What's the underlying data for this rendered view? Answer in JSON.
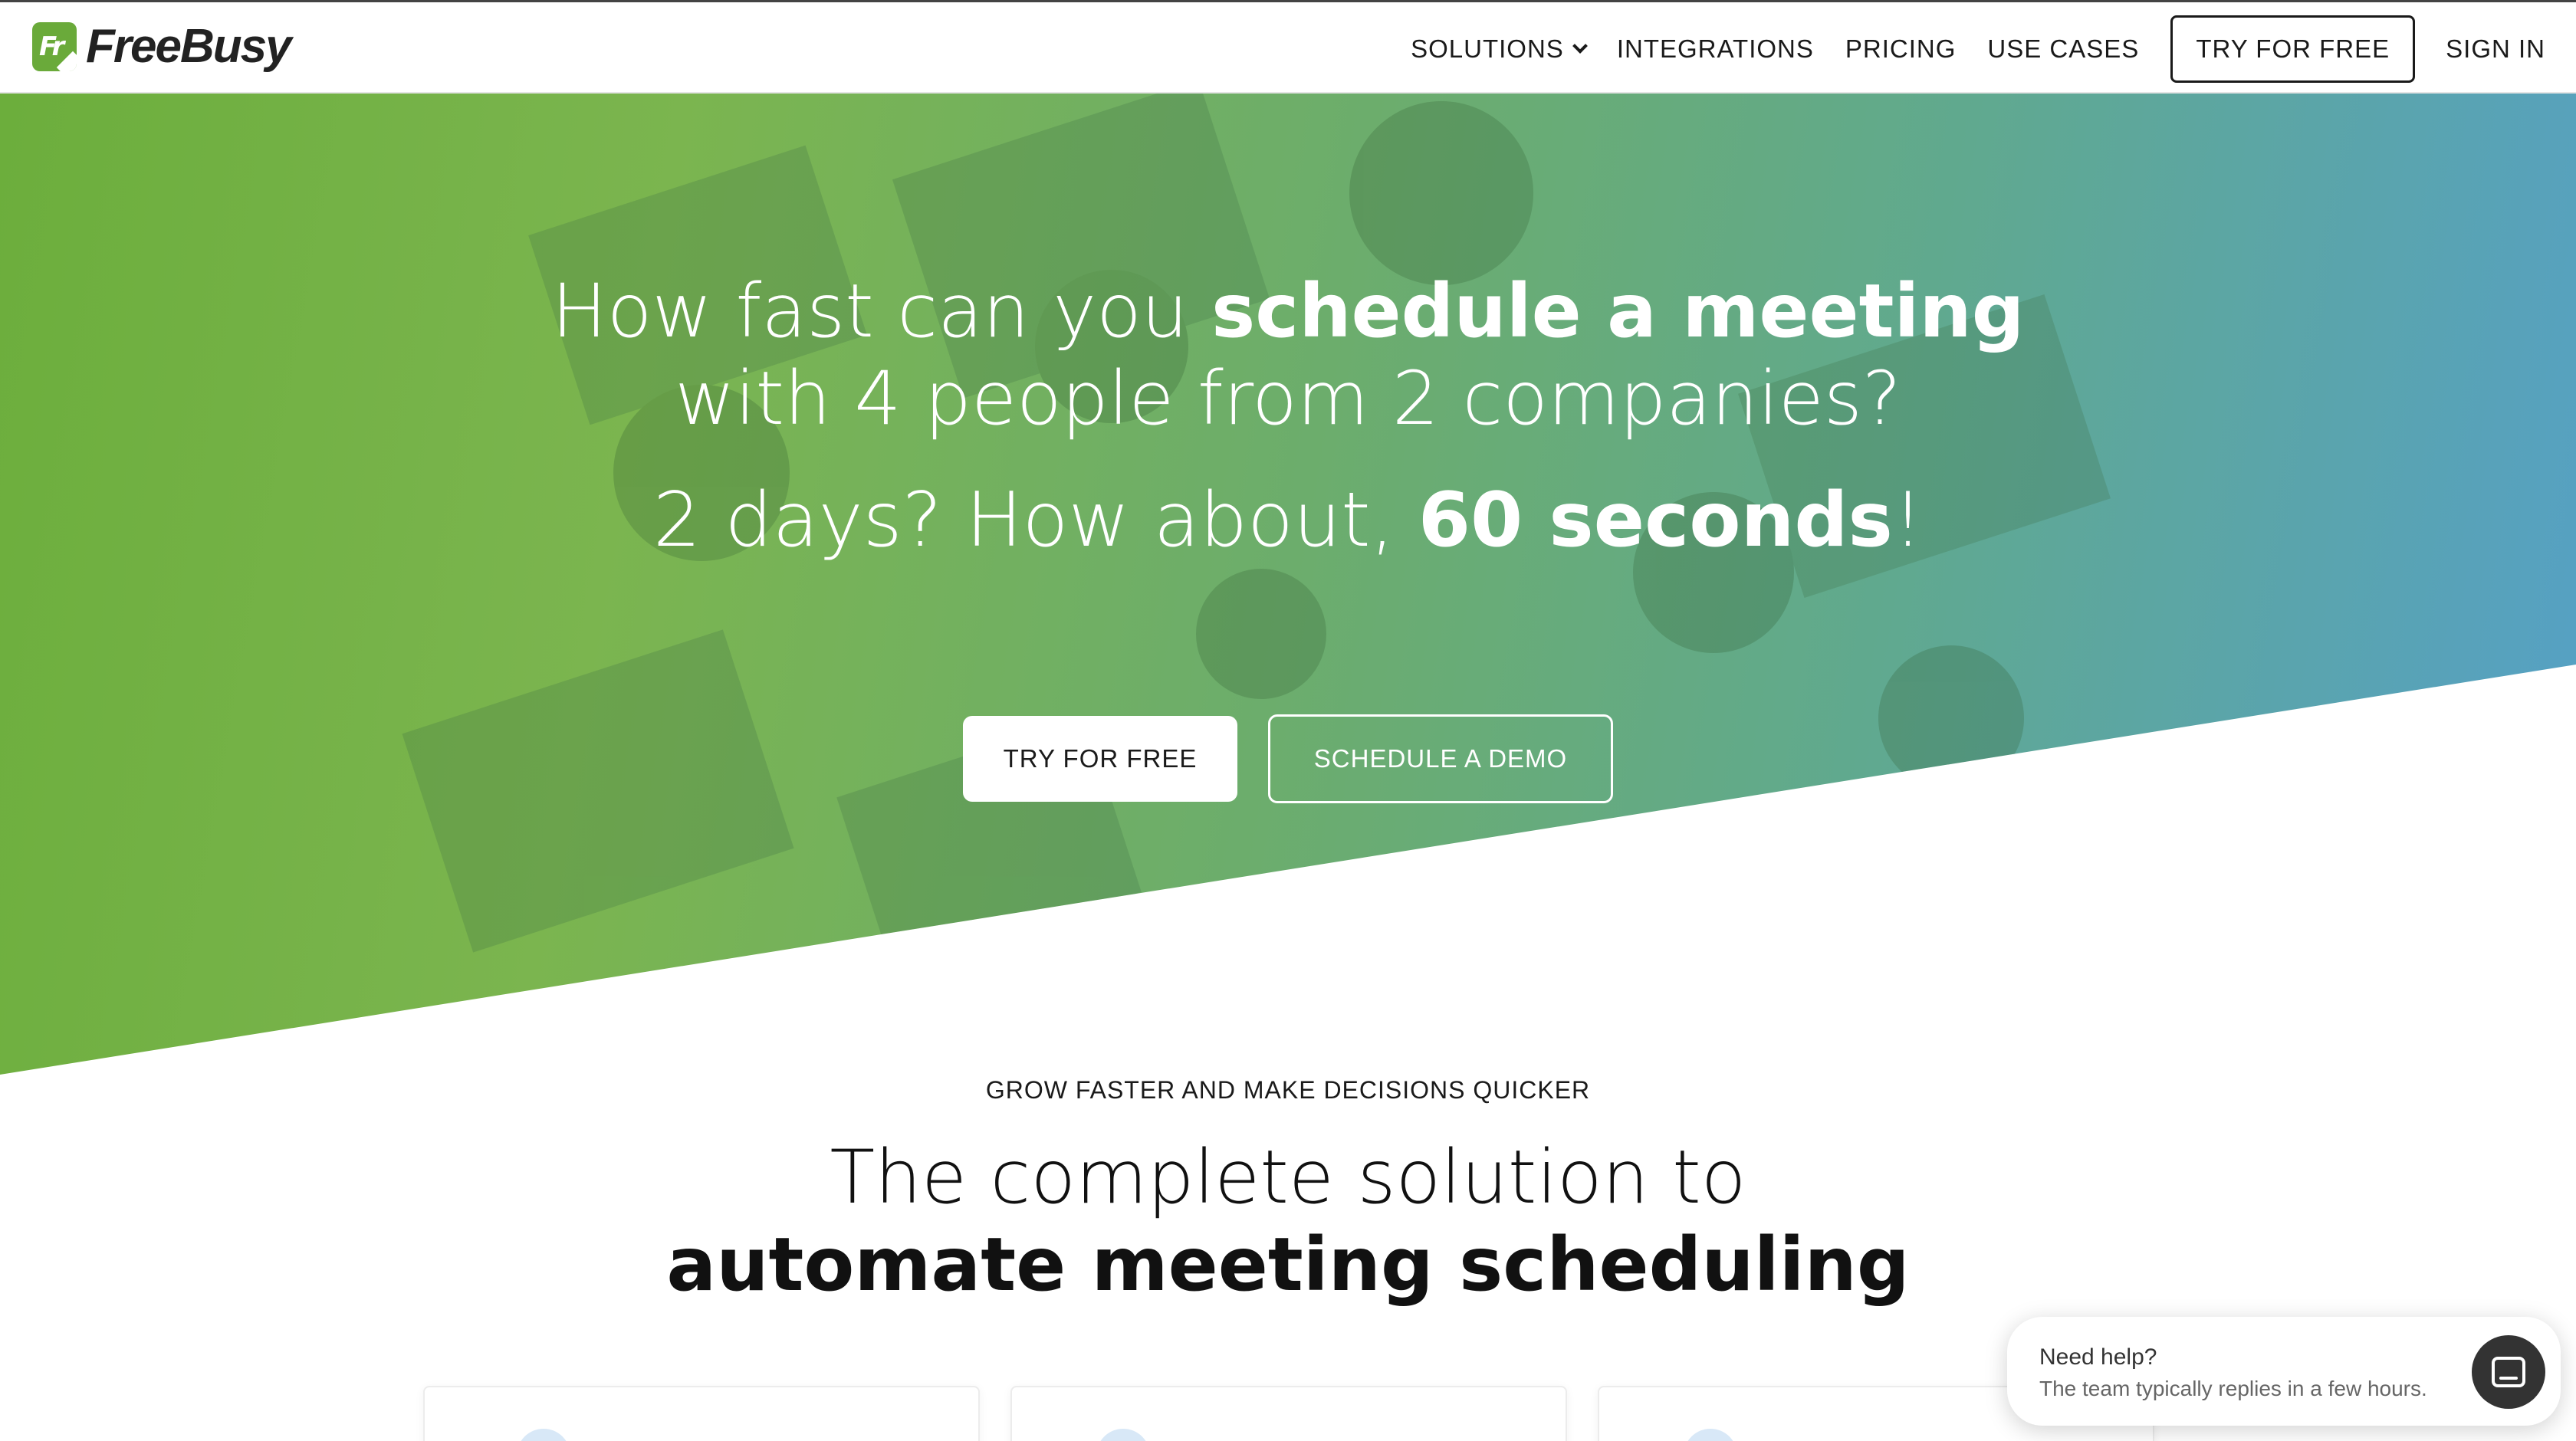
{
  "brand": {
    "name": "FreeBusy",
    "logo_mark": "Fr",
    "accent_green": "#6aaa3a",
    "gradient_end_blue": "#55a0c8"
  },
  "nav": {
    "items": [
      {
        "label": "SOLUTIONS",
        "has_dropdown": true
      },
      {
        "label": "INTEGRATIONS"
      },
      {
        "label": "PRICING"
      },
      {
        "label": "USE CASES"
      }
    ],
    "try_label": "TRY FOR FREE",
    "signin_label": "SIGN IN"
  },
  "hero": {
    "line1_light": "How fast can you ",
    "line1_bold": "schedule a meeting",
    "line2": "with 4 people from 2 companies?",
    "line3_light": "2 days? How about, ",
    "line3_bold": "60 seconds",
    "line3_end": "!",
    "primary_cta": "TRY FOR FREE",
    "secondary_cta": "SCHEDULE A DEMO"
  },
  "section": {
    "eyebrow": "GROW FASTER AND MAKE DECISIONS QUICKER",
    "heading_light": "The complete solution to",
    "heading_bold": "automate meeting scheduling"
  },
  "help_widget": {
    "title": "Need help?",
    "subtitle": "The team typically replies in a few hours.",
    "icon": "chat-icon"
  }
}
